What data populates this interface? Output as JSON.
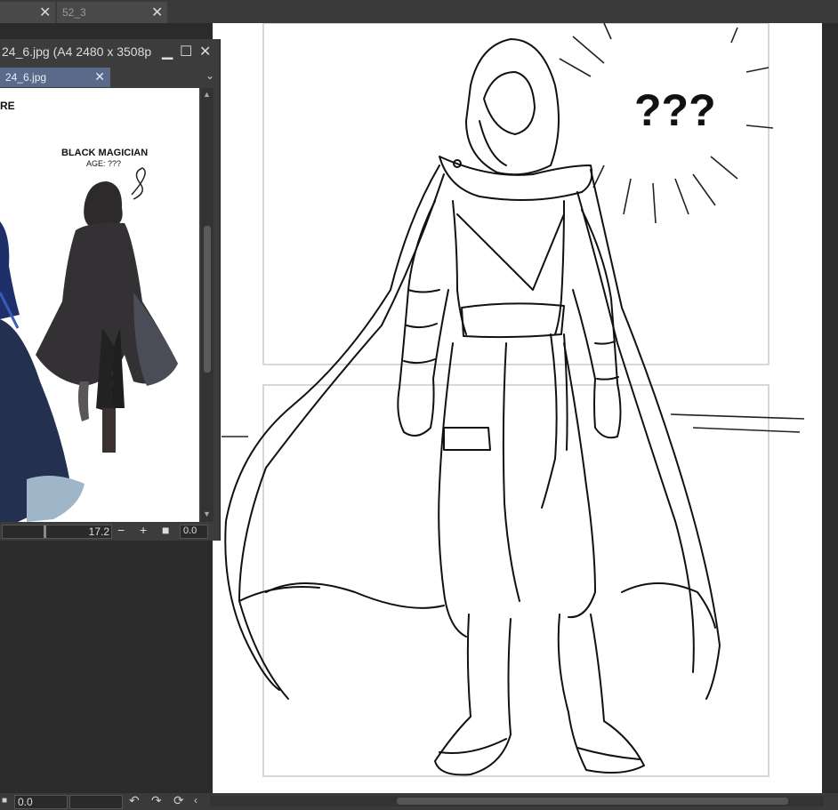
{
  "document_tabs": [
    {
      "label": ""
    },
    {
      "label": "52_3"
    }
  ],
  "navigator": {
    "title": "24_6.jpg (A4 2480 x 3508p",
    "tab_label": "24_6.jpg",
    "preview": {
      "partial_text": "RE",
      "caption_title": "BLACK MAGICIAN",
      "caption_sub": "AGE: ???"
    },
    "zoom_value": "17.2",
    "rotation_value": "0.0"
  },
  "canvas": {
    "speech_text": "???"
  },
  "status_bar": {
    "value": "0.0"
  },
  "colors": {
    "panel_bg": "#3c3c3c",
    "tab_active": "#5a6a8a",
    "canvas_bg": "#2b2b2b",
    "panel_frame": "#d8d8d8"
  }
}
